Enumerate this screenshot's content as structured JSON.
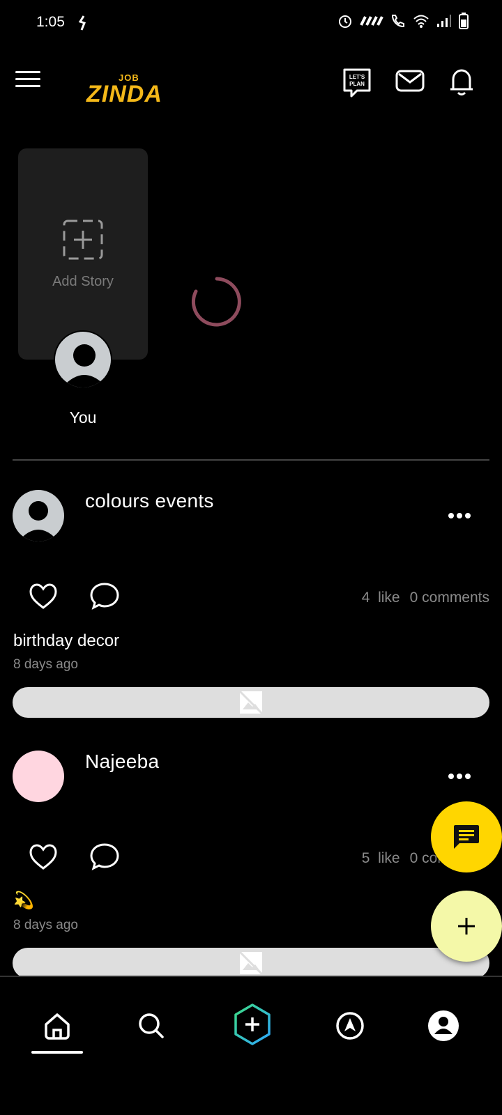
{
  "status_bar": {
    "time": "1:05",
    "icons": [
      "notification-icon",
      "alarm-icon",
      "network-icon",
      "wifi-call-icon",
      "wifi-icon",
      "signal-icon",
      "battery-icon"
    ]
  },
  "header": {
    "logo_small": "JOB",
    "logo_big": "ZINDA",
    "logo_color": "#f4b819",
    "lets_plan_text": "LET'S PLAN",
    "icons": [
      "menu-icon",
      "lets-plan-icon",
      "mail-icon",
      "bell-icon"
    ]
  },
  "stories": {
    "add_story_label": "Add Story",
    "you_label": "You"
  },
  "posts": [
    {
      "author": "colours events",
      "likes": "4",
      "likes_label": "like",
      "comments": "0",
      "comments_label": "comments",
      "caption": "birthday decor",
      "time_ago": "8 days ago",
      "avatar_color": "#c9cdd0"
    },
    {
      "author": "Najeeba",
      "likes": "5",
      "likes_label": "like",
      "comments": "0",
      "comments_label": "comments",
      "caption": "💫",
      "time_ago": "8 days ago",
      "avatar_color": "#ffd6e0"
    }
  ],
  "fab": {
    "chat_color": "#ffd600",
    "add_color": "#f4f8a8"
  },
  "bottom_nav": {
    "items": [
      "home-icon",
      "search-icon",
      "create-post-icon",
      "explore-icon",
      "profile-icon"
    ],
    "active": "home-icon"
  }
}
